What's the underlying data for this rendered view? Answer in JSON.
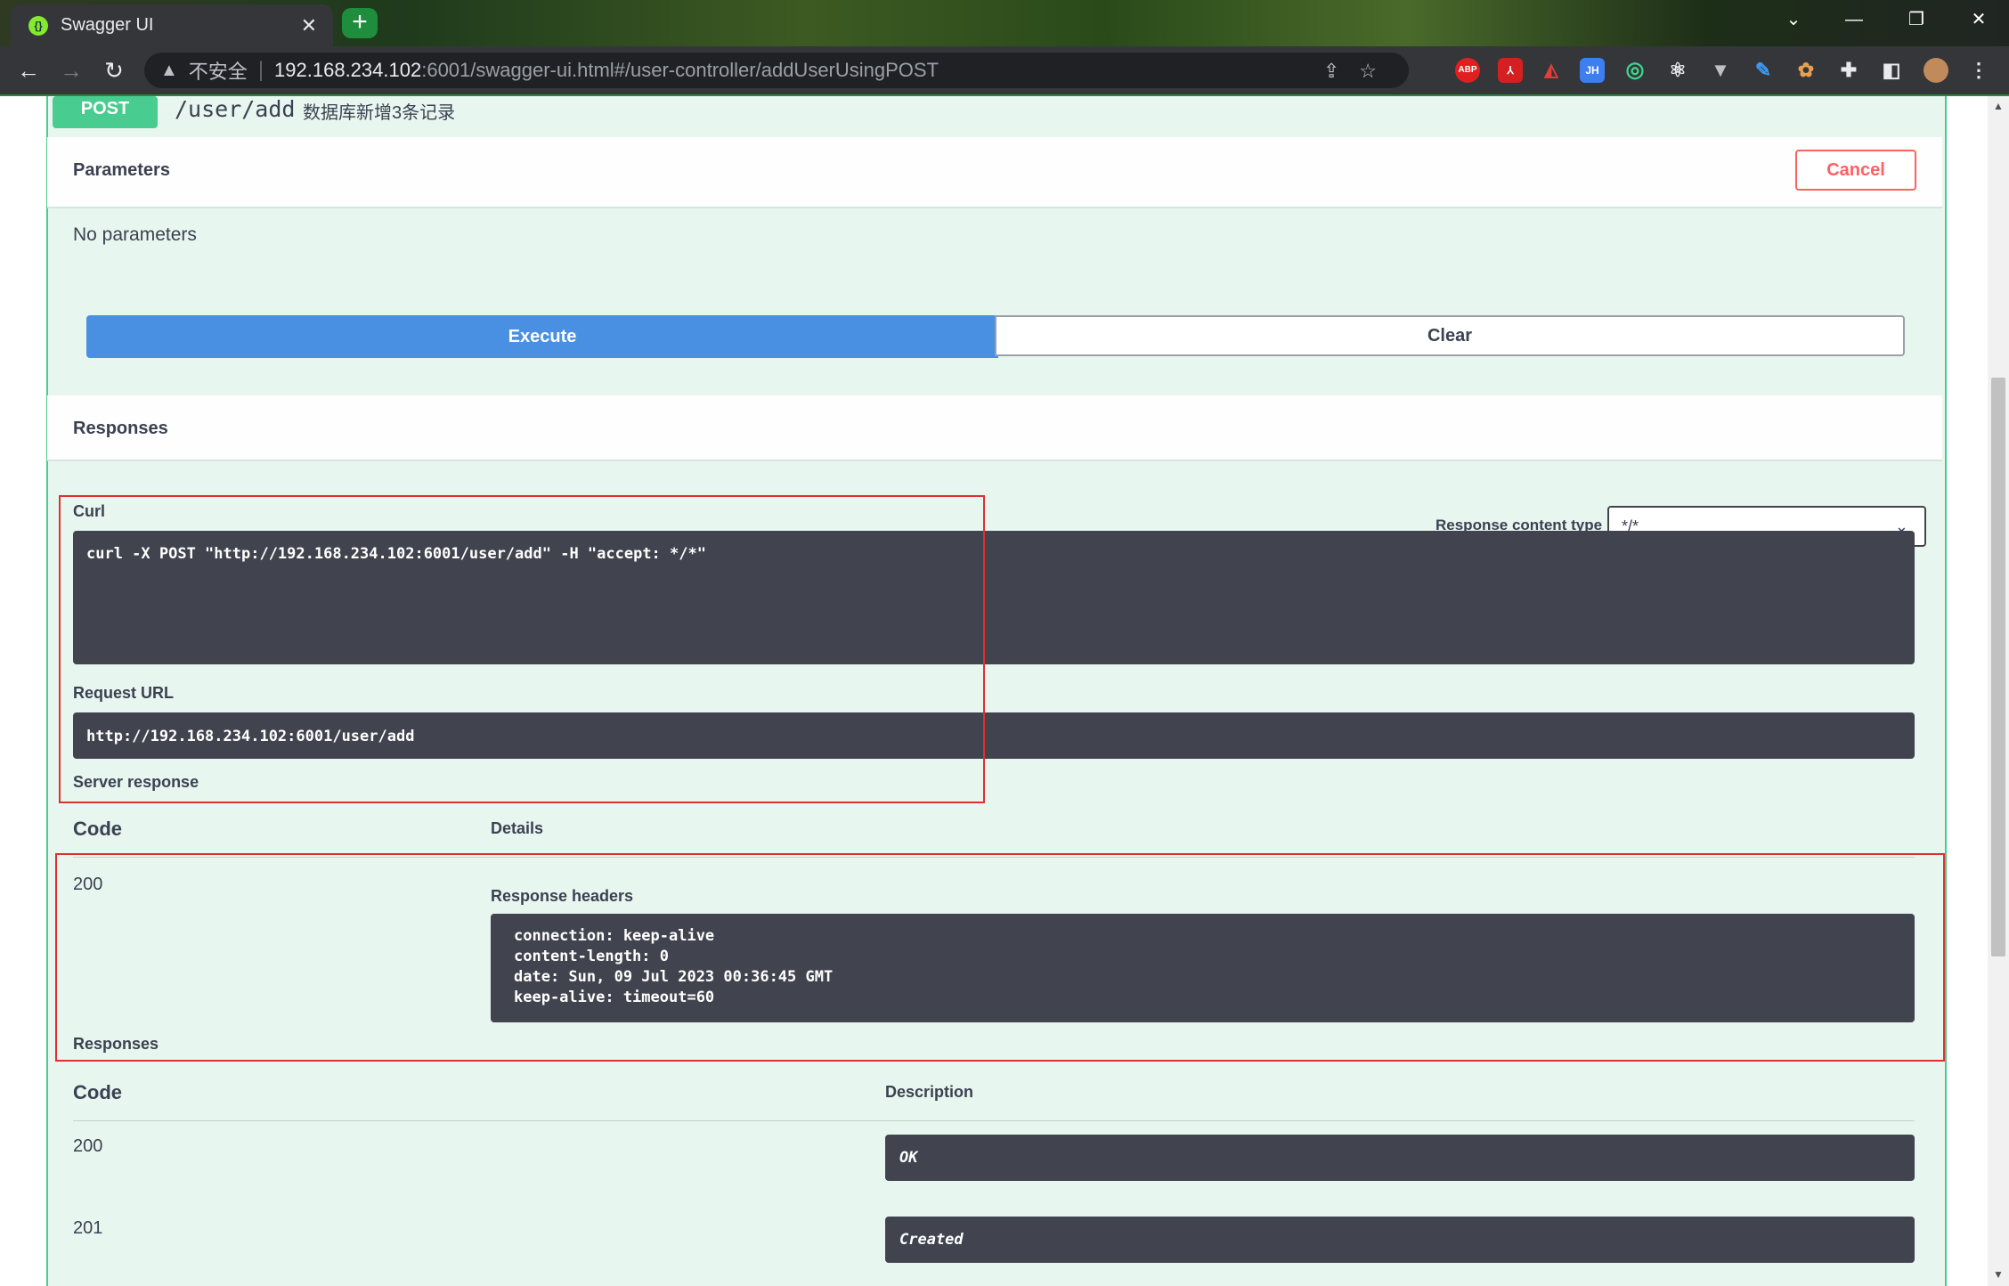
{
  "browser": {
    "tab_title": "Swagger UI",
    "tab_close": "✕",
    "new_tab": "+",
    "insecure_label": "不安全",
    "url_host": "192.168.234.102",
    "url_rest": ":6001/swagger-ui.html#/user-controller/addUserUsingPOST",
    "extensions": [
      "ABP",
      "JH"
    ]
  },
  "operation": {
    "method": "POST",
    "path": "/user/add",
    "summary": "数据库新增3条记录"
  },
  "parameters": {
    "title": "Parameters",
    "cancel_label": "Cancel",
    "none_text": "No parameters"
  },
  "actions": {
    "execute_label": "Execute",
    "clear_label": "Clear"
  },
  "responses_section": {
    "title": "Responses",
    "content_type_label": "Response content type",
    "content_type_value": "*/*"
  },
  "result": {
    "curl_label": "Curl",
    "curl_command": "curl -X POST \"http://192.168.234.102:6001/user/add\" -H \"accept: */*\"",
    "request_url_label": "Request URL",
    "request_url": "http://192.168.234.102:6001/user/add",
    "server_response_label": "Server response",
    "code_header": "Code",
    "details_header": "Details",
    "response_code": "200",
    "response_headers_label": "Response headers",
    "response_headers": "connection: keep-alive\ncontent-length: 0\ndate: Sun, 09 Jul 2023 00:36:45 GMT\nkeep-alive: timeout=60"
  },
  "documented_responses": {
    "title": "Responses",
    "code_header": "Code",
    "description_header": "Description",
    "rows": [
      {
        "code": "200",
        "description": "OK"
      },
      {
        "code": "201",
        "description": "Created"
      }
    ]
  }
}
